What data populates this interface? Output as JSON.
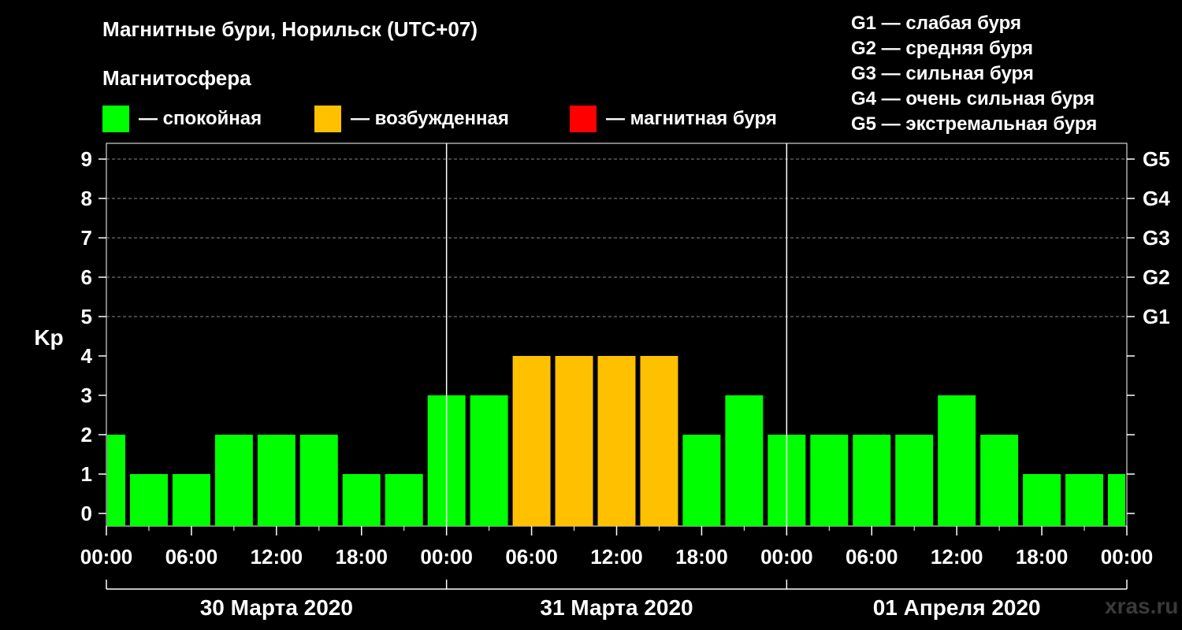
{
  "title": "Магнитные бури, Норильск (UTC+07)",
  "subtitle": "Магнитосфера",
  "legend": [
    {
      "label": "— спокойная",
      "color": "#00ff00"
    },
    {
      "label": "— возбужденная",
      "color": "#ffc000"
    },
    {
      "label": "— магнитная буря",
      "color": "#ff0000"
    }
  ],
  "g_legend": [
    "G1 — слабая буря",
    "G2 — средняя буря",
    "G3 — сильная буря",
    "G4 — очень сильная буря",
    "G5 — экстремальная буря"
  ],
  "watermark": "xras.ru",
  "chart_data": {
    "type": "bar",
    "ylabel": "Kp",
    "ylim": [
      0,
      9
    ],
    "yticks": [
      "0",
      "1",
      "2",
      "3",
      "4",
      "5",
      "6",
      "7",
      "8",
      "9"
    ],
    "right_ticks": [
      {
        "value": 5,
        "label": "G1"
      },
      {
        "value": 6,
        "label": "G2"
      },
      {
        "value": 7,
        "label": "G3"
      },
      {
        "value": 8,
        "label": "G4"
      },
      {
        "value": 9,
        "label": "G5"
      }
    ],
    "grid": "horizontal dashed at 5-9",
    "xticks": [
      "00:00",
      "06:00",
      "12:00",
      "18:00",
      "00:00",
      "06:00",
      "12:00",
      "18:00",
      "00:00",
      "06:00",
      "12:00",
      "18:00",
      "00:00"
    ],
    "days": [
      "30 Марта 2020",
      "31 Марта 2020",
      "01 Апреля 2020"
    ],
    "interval_hours": 3,
    "bar_start_hour": -1.5,
    "values": [
      2,
      1,
      1,
      2,
      2,
      2,
      1,
      1,
      3,
      3,
      4,
      4,
      4,
      4,
      2,
      3,
      2,
      2,
      2,
      2,
      3,
      2,
      1,
      1,
      1
    ],
    "colors": {
      "quiet": "#00ff00",
      "active": "#ffc000",
      "storm": "#ff0000"
    }
  }
}
